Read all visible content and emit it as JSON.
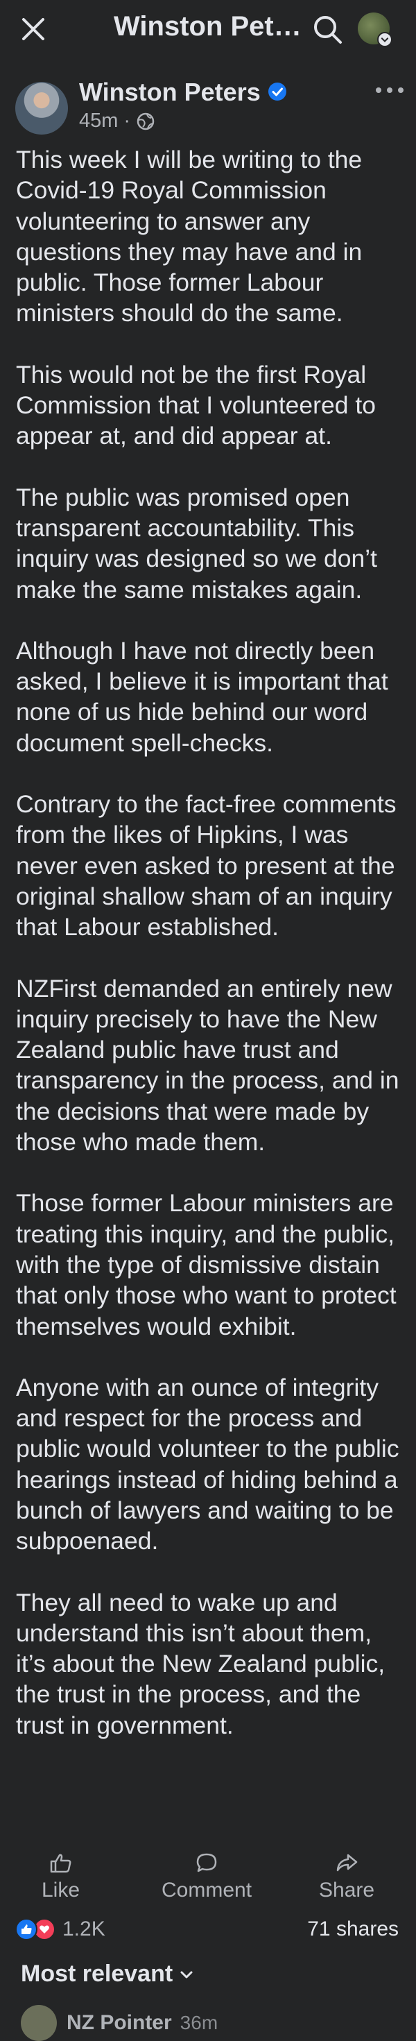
{
  "topbar": {
    "title": "Winston Pet…",
    "close_icon": "close-icon",
    "search_icon": "search-icon"
  },
  "post": {
    "author": "Winston Peters",
    "verified": true,
    "time": "45m",
    "audience_icon": "globe-icon",
    "paragraphs": [
      "This week I will be writing to the Covid-19 Royal Commission volunteering to answer any questions they may have and in public. Those former Labour ministers should do the same.",
      "This would not be the first Royal Commission that I volunteered to appear at, and did appear at.",
      "The public was promised open transparent accountability. This inquiry was designed so we don’t make the same mistakes again.",
      "Although I have not directly been asked, I believe it is important that none of us hide behind our word document spell-checks.",
      "Contrary to the fact-free comments from the likes of Hipkins, I was never even asked to present at the original shallow sham of an inquiry that Labour established.",
      "NZFirst demanded an entirely new inquiry precisely to have the New Zealand public have trust and transparency in the process, and in the decisions that were made by those who made them.",
      "Those former Labour ministers are treating this inquiry, and the public, with the type of dismissive distain that only those who want to protect themselves would exhibit.",
      "Anyone with an ounce of integrity and respect for the process and public would volunteer to the public hearings instead of hiding behind a bunch of lawyers and waiting to be subpoenaed.",
      "They all need to wake up and understand this isn’t about them, it’s about the New Zealand public, the trust in the process, and the trust in government."
    ]
  },
  "actions": {
    "like": "Like",
    "comment": "Comment",
    "share": "Share"
  },
  "stats": {
    "reactions": "1.2K",
    "shares": "71 shares"
  },
  "comments": {
    "sort_label": "Most relevant",
    "first_author": "NZ Pointer",
    "first_time": "36m"
  },
  "colors": {
    "background": "#242526",
    "text": "#e4e6eb",
    "muted": "#b0b3b8",
    "verified": "#1877f2",
    "like": "#1877f2",
    "love": "#f33e58"
  }
}
